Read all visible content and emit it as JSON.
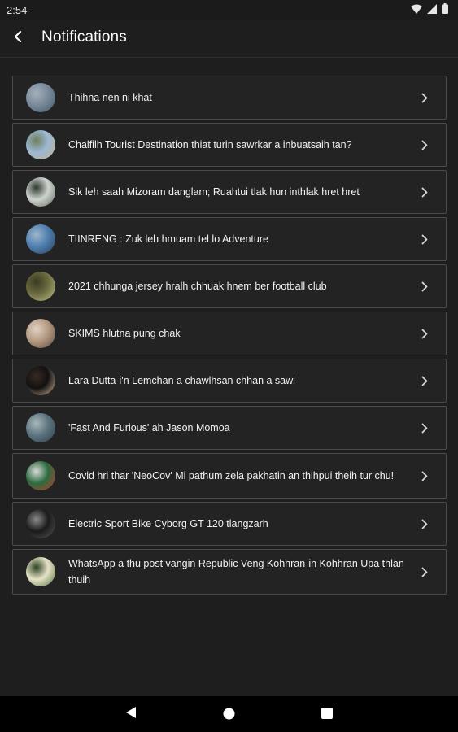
{
  "status_bar": {
    "time": "2:54"
  },
  "app_bar": {
    "title": "Notifications"
  },
  "notifications": [
    {
      "title": "Thihna nen ni khat",
      "thumb_colors": [
        "#7a8a9a",
        "#3d5a6b",
        "#a3b1b9"
      ]
    },
    {
      "title": "Chalfilh Tourist Destination thiat turin sawrkar a inbuatsaih tan?",
      "thumb_colors": [
        "#9bb8d6",
        "#c7b28d",
        "#6f7f5a"
      ]
    },
    {
      "title": "Sik leh saah Mizoram danglam; Ruahtui tlak hun inthlak hret hret",
      "thumb_colors": [
        "#cfd3cf",
        "#5c6b5a",
        "#2e3a2e"
      ]
    },
    {
      "title": "TIINRENG : Zuk leh hmuam tel lo Adventure",
      "thumb_colors": [
        "#4f7fb0",
        "#2a3e55",
        "#9fb6c9"
      ]
    },
    {
      "title": "2021 chhunga jersey hralh chhuak hnem ber football club",
      "thumb_colors": [
        "#6b6a3f",
        "#c2c08a",
        "#3a3a22"
      ]
    },
    {
      "title": "SKIMS hlutna pung chak",
      "thumb_colors": [
        "#b59a82",
        "#5b4a3e",
        "#e0d2c2"
      ]
    },
    {
      "title": "Lara Dutta-i'n Lemchan a chawlhsan chhan a sawi",
      "thumb_colors": [
        "#111111",
        "#d2b59c",
        "#3a2a22"
      ]
    },
    {
      "title": "'Fast And Furious' ah Jason Momoa",
      "thumb_colors": [
        "#5d7580",
        "#2f3d44",
        "#a9b6bb"
      ]
    },
    {
      "title": "Covid hri thar 'NeoCov'  Mi pathum zela pakhatin an thihpui theih tur chu!",
      "thumb_colors": [
        "#2c6b3f",
        "#c23b2f",
        "#d9d9d9"
      ]
    },
    {
      "title": "Electric Sport Bike Cyborg GT 120 tlangzarh",
      "thumb_colors": [
        "#1b1b1b",
        "#555555",
        "#8a8a8a"
      ]
    },
    {
      "title": "WhatsApp a thu post vangin Republic Veng Kohhran-in Kohhran Upa thlan thuih",
      "thumb_colors": [
        "#e7e3c8",
        "#4f6f3a",
        "#2d4423"
      ]
    }
  ]
}
